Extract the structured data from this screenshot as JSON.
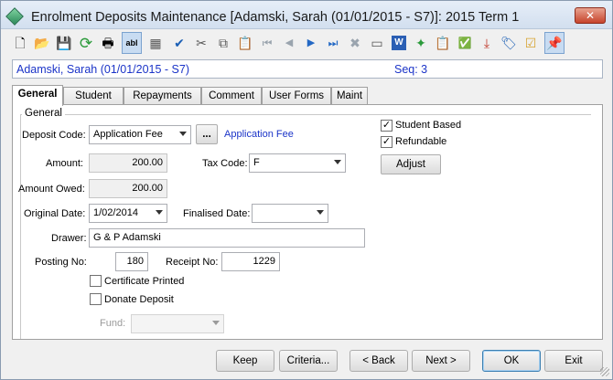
{
  "window": {
    "title": "Enrolment Deposits Maintenance  [Adamski, Sarah (01/01/2015 - S7)]:  2015 Term 1",
    "close_glyph": "✕"
  },
  "toolbar": {
    "icons": [
      {
        "name": "new-icon",
        "glyph": "🗋"
      },
      {
        "name": "open-icon",
        "glyph": "📂"
      },
      {
        "name": "save-icon",
        "glyph": "💾"
      },
      {
        "name": "refresh-icon",
        "glyph": "⟳"
      },
      {
        "name": "print-icon",
        "glyph": "🖶"
      },
      {
        "name": "text-field-icon",
        "glyph": "abl"
      },
      {
        "name": "calculator-icon",
        "glyph": "▦"
      },
      {
        "name": "spellcheck-icon",
        "glyph": "✔"
      },
      {
        "name": "cut-icon",
        "glyph": "✂"
      },
      {
        "name": "copy-icon",
        "glyph": "⧉"
      },
      {
        "name": "paste-icon",
        "glyph": "📋"
      },
      {
        "name": "first-record-icon",
        "glyph": "⏮"
      },
      {
        "name": "previous-record-icon",
        "glyph": "◀"
      },
      {
        "name": "next-record-icon",
        "glyph": "▶"
      },
      {
        "name": "last-record-icon",
        "glyph": "⏭"
      },
      {
        "name": "delete-icon",
        "glyph": "✖"
      },
      {
        "name": "card-icon",
        "glyph": "▭"
      },
      {
        "name": "word-icon",
        "glyph": "W"
      },
      {
        "name": "wizard-icon",
        "glyph": "✦"
      },
      {
        "name": "clipboard-list-icon",
        "glyph": "📋"
      },
      {
        "name": "approve-icon",
        "glyph": "✅"
      },
      {
        "name": "download-icon",
        "glyph": "⤓"
      },
      {
        "name": "tag-icon",
        "glyph": "🏷"
      },
      {
        "name": "checklist-icon",
        "glyph": "☑"
      },
      {
        "name": "pin-icon",
        "glyph": "📌"
      }
    ]
  },
  "infobar": {
    "student": "Adamski, Sarah (01/01/2015 - S7)",
    "seq": "Seq: 3"
  },
  "tabs": [
    "General",
    "Student",
    "Repayments",
    "Comment",
    "User Forms",
    "Maint"
  ],
  "form": {
    "group_label": "General",
    "deposit_code_label": "Deposit Code:",
    "deposit_code_value": "Application Fee",
    "lookup_button": "...",
    "deposit_code_desc": "Application Fee",
    "amount_label": "Amount:",
    "amount_value": "200.00",
    "tax_code_label": "Tax Code:",
    "tax_code_value": "F",
    "amount_owed_label": "Amount Owed:",
    "amount_owed_value": "200.00",
    "original_date_label": "Original Date:",
    "original_date_value": "1/02/2014",
    "finalised_date_label": "Finalised Date:",
    "finalised_date_value": "",
    "drawer_label": "Drawer:",
    "drawer_value": "G & P Adamski",
    "posting_no_label": "Posting No:",
    "posting_no_value": "180",
    "receipt_no_label": "Receipt No:",
    "receipt_no_value": "1229",
    "certificate_printed_label": "Certificate Printed",
    "donate_deposit_label": "Donate Deposit",
    "fund_label": "Fund:",
    "fund_value": "",
    "student_based_label": "Student Based",
    "refundable_label": "Refundable",
    "adjust_button": "Adjust",
    "check_glyph": "✓"
  },
  "footer": {
    "keep": "Keep",
    "criteria": "Criteria...",
    "back": "< Back",
    "next": "Next >",
    "ok": "OK",
    "exit": "Exit"
  }
}
